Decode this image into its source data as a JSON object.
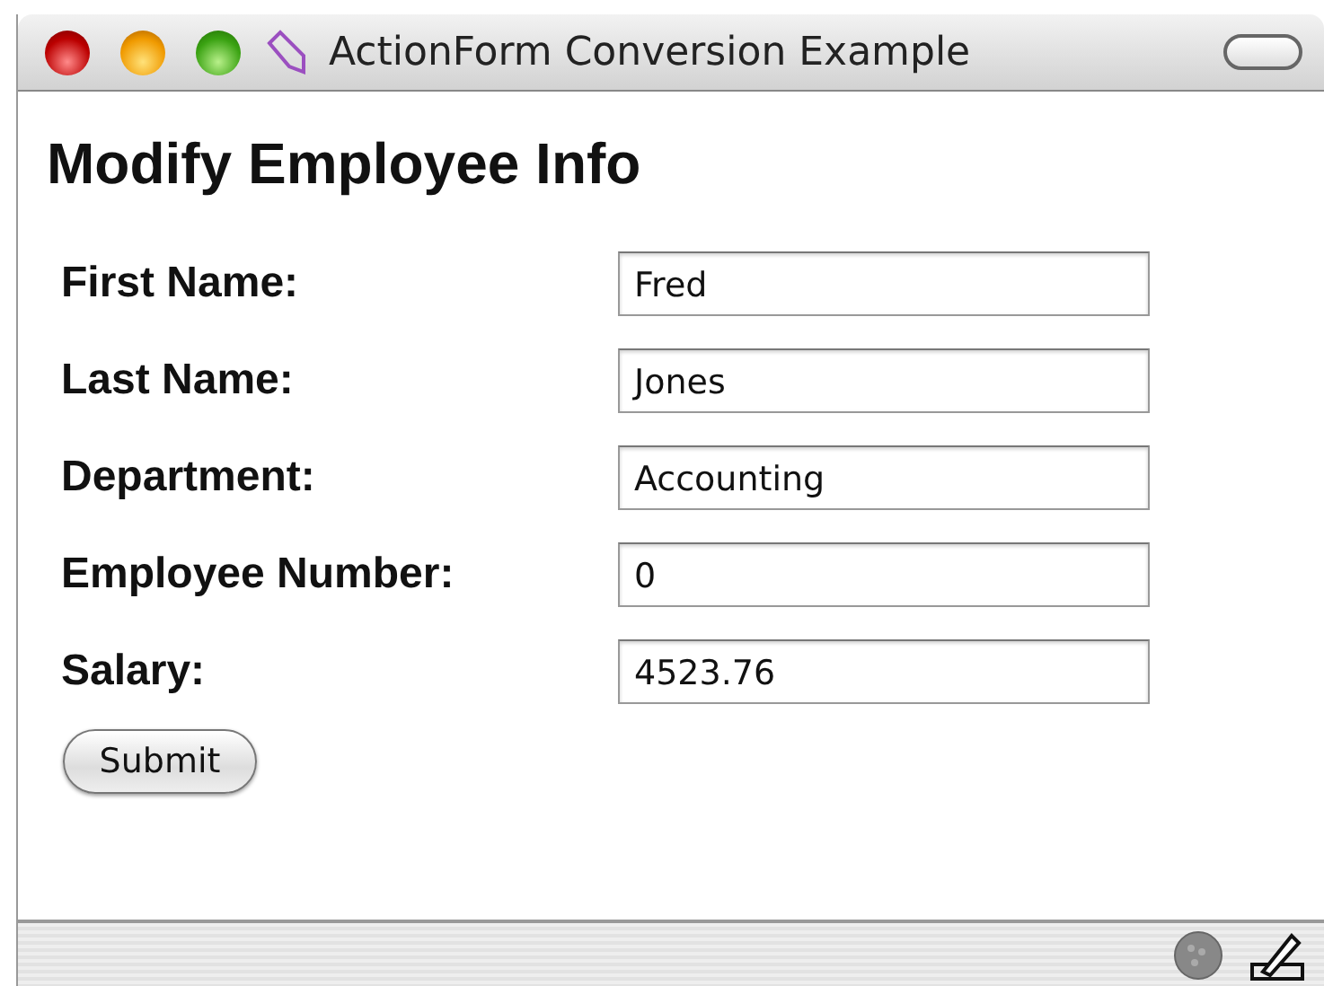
{
  "window": {
    "title": "ActionForm Conversion Example"
  },
  "heading": "Modify Employee Info",
  "fields": [
    {
      "label": "First Name:",
      "value": "Fred"
    },
    {
      "label": "Last Name:",
      "value": "Jones"
    },
    {
      "label": "Department:",
      "value": "Accounting"
    },
    {
      "label": "Employee Number:",
      "value": "0"
    },
    {
      "label": "Salary:",
      "value": "4523.76"
    }
  ],
  "buttons": [
    "Submit"
  ]
}
